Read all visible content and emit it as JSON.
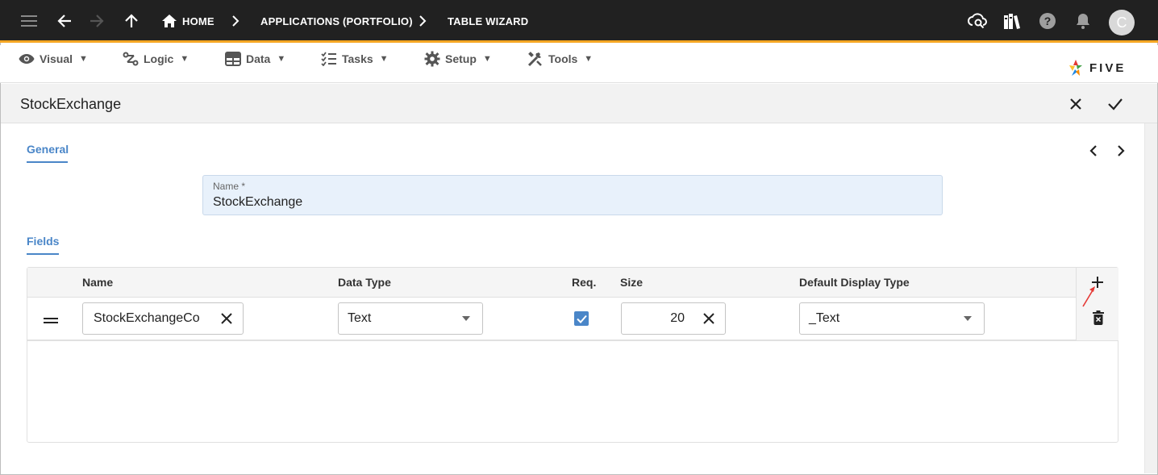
{
  "topbar": {
    "breadcrumbs": [
      "HOME",
      "APPLICATIONS (PORTFOLIO)",
      "TABLE WIZARD"
    ],
    "avatar_initial": "C",
    "icons": [
      "menu-icon",
      "back-arrow-icon",
      "forward-arrow-icon",
      "up-arrow-icon",
      "home-icon",
      "cloud-search-icon",
      "library-icon",
      "help-icon",
      "bell-icon"
    ]
  },
  "menu": {
    "items": [
      {
        "label": "Visual",
        "icon": "eye-icon"
      },
      {
        "label": "Logic",
        "icon": "flow-icon"
      },
      {
        "label": "Data",
        "icon": "table-icon"
      },
      {
        "label": "Tasks",
        "icon": "checklist-icon"
      },
      {
        "label": "Setup",
        "icon": "gear-icon"
      },
      {
        "label": "Tools",
        "icon": "tools-icon"
      }
    ],
    "caret": "▼",
    "logo_text": "FIVE"
  },
  "form": {
    "title": "StockExchange",
    "tabs": {
      "general": "General",
      "fields": "Fields"
    },
    "name_field": {
      "label": "Name *",
      "value": "StockExchange"
    }
  },
  "grid": {
    "columns": [
      "Name",
      "Data Type",
      "Req.",
      "Size",
      "Default Display Type"
    ],
    "rows": [
      {
        "name": "StockExchangeCo",
        "data_type": "Text",
        "required": true,
        "size": "20",
        "display_type": "_Text"
      }
    ]
  },
  "colors": {
    "accent": "#4a86c8",
    "topbar": "#212121",
    "topbar_border": "#f5a623"
  }
}
